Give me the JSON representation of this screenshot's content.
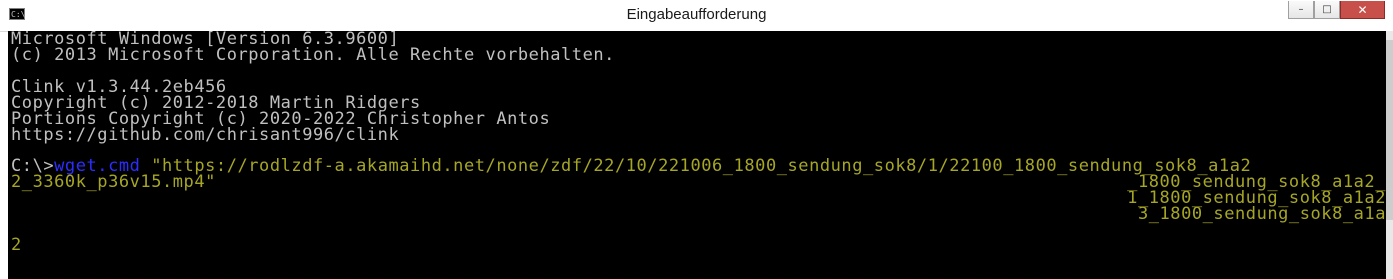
{
  "window": {
    "title": "Eingabeaufforderung",
    "icon": "console-icon",
    "buttons": {
      "minimize": "–",
      "maximize": "□",
      "close": "✕"
    }
  },
  "console": {
    "lines": [
      "Microsoft Windows [Version 6.3.9600]",
      "(c) 2013 Microsoft Corporation. Alle Rechte vorbehalten.",
      "",
      "Clink v1.3.44.2eb456",
      "Copyright (c) 2012-2018 Martin Ridgers",
      "Portions Copyright (c) 2020-2022 Christopher Antos",
      "https://github.com/chrisant996/clink"
    ],
    "prompt": "C:\\>",
    "command": "wget.cmd",
    "argument_line1": " \"https://rodlzdf-a.akamaihd.net/none/zdf/22/10/221006_1800_sendung_sok8/1/22100_1800_sendung_sok8_a1a2",
    "argument_line2": "2_3360k_p36v15.mp4\"",
    "right_fragments": [
      "_1800_sendung_sok8_a1a2_",
      "1_1800_sendung_sok8_a1a2",
      "3_1800_sendung_sok8_a1a"
    ],
    "cursor_line": "2"
  },
  "colors": {
    "background": "#000000",
    "text": "#c0c0c0",
    "command": "#2d2dff",
    "argument": "#a6a626"
  }
}
